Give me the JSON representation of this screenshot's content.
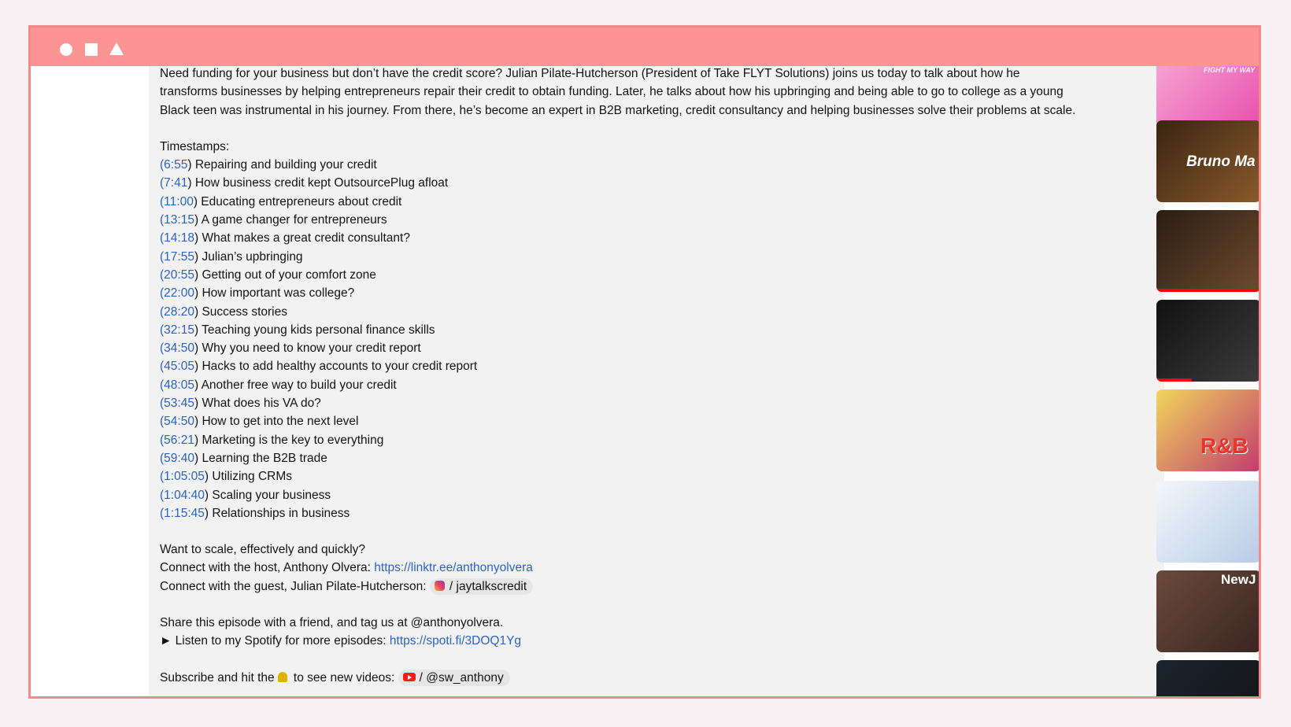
{
  "window": {
    "controls": [
      "circle-icon",
      "square-icon",
      "triangle-icon"
    ]
  },
  "description": {
    "intro_lines": [
      "Need funding for your business but don’t have the credit score? Julian Pilate-Hutcherson (President of Take FLYT Solutions) joins us today to talk about how he",
      "transforms businesses by helping entrepreneurs repair their credit to obtain funding. Later, he talks about how his upbringing and being able to go to college as a young",
      "Black teen was instrumental in his journey. From there, he’s become an expert in B2B marketing, credit consultancy and helping businesses solve their problems at scale."
    ],
    "timestamps_heading": "Timestamps:",
    "timestamps": [
      {
        "time": "6:55",
        "label": " Repairing and building your credit"
      },
      {
        "time": "7:41",
        "label": " How business credit kept OutsourcePlug afloat"
      },
      {
        "time": "11:00",
        "label": " Educating entrepreneurs about credit"
      },
      {
        "time": "13:15",
        "label": " A game changer for entrepreneurs"
      },
      {
        "time": "14:18",
        "label": " What makes a great credit consultant?"
      },
      {
        "time": "17:55",
        "label": " Julian’s upbringing"
      },
      {
        "time": "20:55",
        "label": " Getting out of your comfort zone"
      },
      {
        "time": "22:00",
        "label": " How important was college?"
      },
      {
        "time": "28:20",
        "label": " Success stories"
      },
      {
        "time": "32:15",
        "label": " Teaching young kids personal finance skills"
      },
      {
        "time": "34:50",
        "label": " Why you need to know your credit report"
      },
      {
        "time": "45:05",
        "label": " Hacks to add healthy accounts to your credit report"
      },
      {
        "time": "48:05",
        "label": " Another free way to build your credit"
      },
      {
        "time": "53:45",
        "label": " What does his VA do?"
      },
      {
        "time": "54:50",
        "label": " How to get into the next level"
      },
      {
        "time": "56:21",
        "label": " Marketing is the key to everything"
      },
      {
        "time": "59:40",
        "label": " Learning the B2B trade"
      },
      {
        "time": "1:05:05",
        "label": " Utilizing CRMs"
      },
      {
        "time": "1:04:40",
        "label": " Scaling your business"
      },
      {
        "time": "1:15:45",
        "label": " Relationships in business"
      }
    ],
    "scale_question": "Want to scale, effectively and quickly?",
    "host_prefix": "Connect with the host, Anthony Olvera: ",
    "host_link": "https://linktr.ee/anthonyolvera",
    "guest_prefix": "Connect with the guest, Julian Pilate-Hutcherson: ",
    "guest_handle": "/ jaytalkscredit",
    "share_line": "Share this episode with a friend, and tag us at @anthonyolvera.",
    "spotify_prefix": "► Listen to my Spotify for more episodes: ",
    "spotify_link": "https://spoti.fi/3DOQ1Yg",
    "subscribe_prefix": "Subscribe and hit the",
    "subscribe_suffix": " to see new videos: ",
    "youtube_handle": "/ @sw_anthony"
  },
  "thumbnails": [
    {
      "caption": "FIGHT MY WAY",
      "colors": [
        "#f7a6d6",
        "#e64aa8"
      ]
    },
    {
      "caption": "Bruno Ma",
      "colors": [
        "#3a2412",
        "#8a5a2b"
      ]
    },
    {
      "caption": "",
      "colors": [
        "#2a1d14",
        "#6e4a2e"
      ]
    },
    {
      "caption": "",
      "colors": [
        "#111111",
        "#3c3c3c"
      ]
    },
    {
      "caption": "R&B",
      "colors": [
        "#f0d65c",
        "#c23b6e"
      ]
    },
    {
      "caption": "",
      "colors": [
        "#f4f7fb",
        "#b7cce6"
      ]
    },
    {
      "caption": "NewJ",
      "colors": [
        "#6a4a3c",
        "#3a2520"
      ]
    },
    {
      "caption": "",
      "colors": [
        "#1b2430",
        "#121212"
      ]
    }
  ]
}
